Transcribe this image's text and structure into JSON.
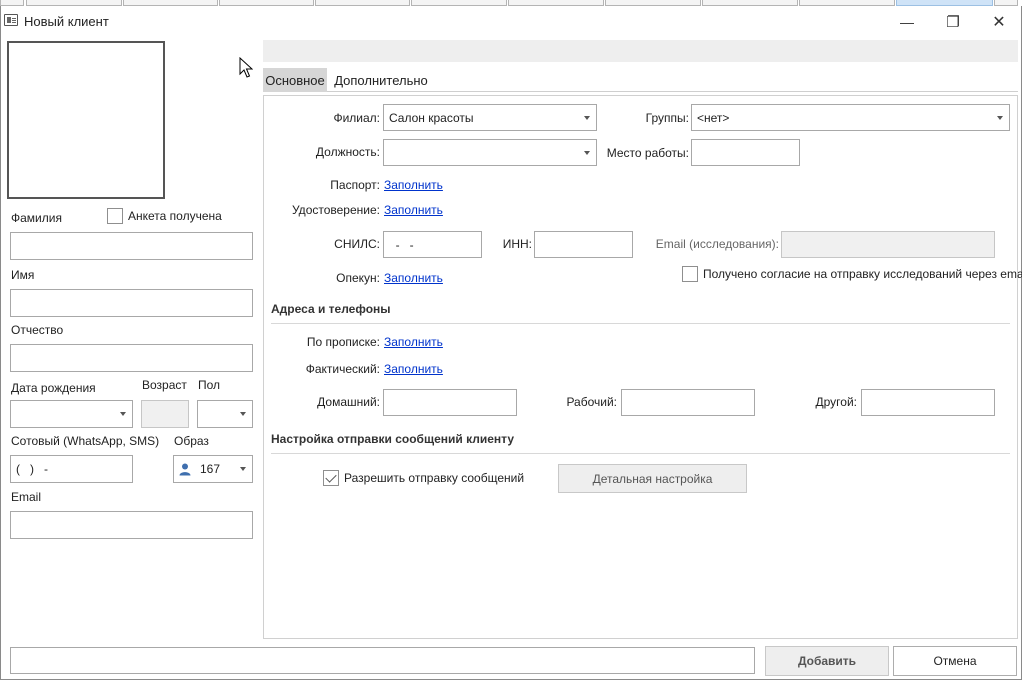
{
  "window": {
    "title": "Новый клиент",
    "minimize_glyph": "—",
    "restore_glyph": "❐",
    "close_glyph": "✕"
  },
  "left": {
    "surname_label": "Фамилия",
    "questionnaire_label": "Анкета получена",
    "name_label": "Имя",
    "patronymic_label": "Отчество",
    "birthdate_label": "Дата рождения",
    "age_label": "Возраст",
    "gender_label": "Пол",
    "mobile_label": "Сотовый (WhatsApp, SMS)",
    "mobile_value": "(   )   -",
    "image_label": "Образ",
    "image_value": "167",
    "email_label": "Email"
  },
  "tabs": [
    {
      "label": "Основное",
      "active": true
    },
    {
      "label": "Дополнительно",
      "active": false
    }
  ],
  "main": {
    "branch_label": "Филиал:",
    "branch_value": "Салон красоты",
    "groups_label": "Группы:",
    "groups_value": "<нет>",
    "position_label": "Должность:",
    "workplace_label": "Место работы:",
    "passport_label": "Паспорт:",
    "passport_link": "Заполнить",
    "id_label": "Удостоверение:",
    "id_link": "Заполнить",
    "snils_label": "СНИЛС:",
    "snils_value": "  -   -",
    "inn_label": "ИНН:",
    "email_research_label": "Email (исследования):",
    "guardian_label": "Опекун:",
    "guardian_link": "Заполнить",
    "consent_label": "Получено согласие на отправку исследований через email"
  },
  "addresses": {
    "title": "Адреса и телефоны",
    "registration_label": "По прописке:",
    "registration_link": "Заполнить",
    "actual_label": "Фактический:",
    "actual_link": "Заполнить",
    "home_label": "Домашний:",
    "work_label": "Рабочий:",
    "other_label": "Другой:"
  },
  "messaging": {
    "title": "Настройка отправки сообщений клиенту",
    "allow_label": "Разрешить отправку сообщений",
    "allow_checked": true,
    "detail_button": "Детальная настройка"
  },
  "footer": {
    "add_button": "Добавить",
    "cancel_button": "Отмена"
  }
}
